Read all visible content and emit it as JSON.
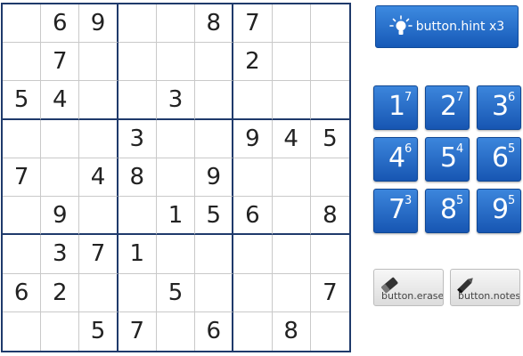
{
  "board": {
    "rows": [
      [
        "",
        "6",
        "9",
        "",
        "",
        "8",
        "7",
        "",
        ""
      ],
      [
        "",
        "7",
        "",
        "",
        "",
        "",
        "2",
        "",
        ""
      ],
      [
        "5",
        "4",
        "",
        "",
        "3",
        "",
        "",
        "",
        ""
      ],
      [
        "",
        "",
        "",
        "3",
        "",
        "",
        "9",
        "4",
        "5"
      ],
      [
        "7",
        "",
        "4",
        "8",
        "",
        "9",
        "",
        "",
        ""
      ],
      [
        "",
        "9",
        "",
        "",
        "1",
        "5",
        "6",
        "",
        "8"
      ],
      [
        "",
        "3",
        "7",
        "1",
        "",
        "",
        "",
        "",
        ""
      ],
      [
        "6",
        "2",
        "",
        "",
        "5",
        "",
        "",
        "",
        "7"
      ],
      [
        "",
        "",
        "5",
        "7",
        "",
        "6",
        "",
        "8",
        ""
      ]
    ]
  },
  "hint": {
    "label": "button.hint x3",
    "icon": "lightbulb-icon"
  },
  "numpad": [
    {
      "number": "1",
      "remaining": "7"
    },
    {
      "number": "2",
      "remaining": "7"
    },
    {
      "number": "3",
      "remaining": "6"
    },
    {
      "number": "4",
      "remaining": "6"
    },
    {
      "number": "5",
      "remaining": "4"
    },
    {
      "number": "6",
      "remaining": "5"
    },
    {
      "number": "7",
      "remaining": "3"
    },
    {
      "number": "8",
      "remaining": "5"
    },
    {
      "number": "9",
      "remaining": "5"
    }
  ],
  "tools": {
    "erase": {
      "label": "button.erase",
      "icon": "eraser-icon"
    },
    "notes": {
      "label": "button.notes",
      "icon": "pencil-icon"
    }
  },
  "colors": {
    "accent": "#1f6ed4",
    "grid_line": "#1f3a6b"
  }
}
